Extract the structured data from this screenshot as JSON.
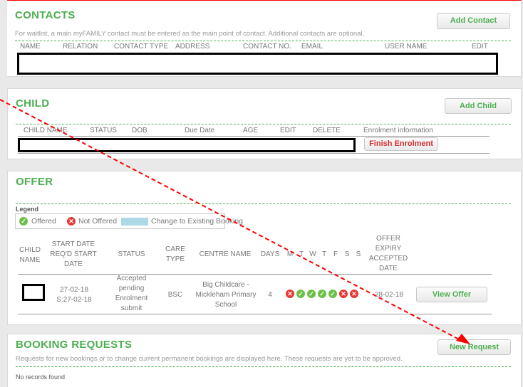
{
  "contacts": {
    "title": "CONTACTS",
    "note": "For waitlist, a main myFAMILY contact must be entered as the main point of contact. Additional contacts are optional.",
    "add_label": "Add Contact",
    "columns": [
      "NAME",
      "RELATION",
      "CONTACT TYPE",
      "ADDRESS",
      "CONTACT NO.",
      "EMAIL",
      "USER NAME",
      "EDIT"
    ]
  },
  "child": {
    "title": "CHILD",
    "add_label": "Add Child",
    "columns": [
      "CHILD NAME",
      "STATUS",
      "DOB",
      "Due Date",
      "AGE",
      "EDIT",
      "DELETE",
      "Enrolment information"
    ],
    "finish_label": "Finish Enrolment"
  },
  "offer": {
    "title": "OFFER",
    "legend_label": "Legend",
    "legend": {
      "offered": "Offered",
      "not_offered": "Not Offered",
      "change": "Change to Existing Booking"
    },
    "columns": {
      "child_name": "CHILD NAME",
      "start_date": "START DATE REQ'D START DATE",
      "status": "STATUS",
      "care_type": "CARE TYPE",
      "centre_name": "CENTRE NAME",
      "days": "DAYS",
      "weekdays": [
        "M",
        "T",
        "W",
        "T",
        "F",
        "S",
        "S"
      ],
      "expiry": "OFFER EXPIRY ACCEPTED DATE"
    },
    "row": {
      "start_date": "27-02-18",
      "reqd_start": "S:27-02-18",
      "status": "Accepted pending Enrolment submit",
      "care_type": "BSC",
      "centre": "Big Childcare - Mickleham Primary School",
      "days": "4",
      "day_status": [
        "not_offered",
        "offered",
        "offered",
        "offered",
        "offered",
        "not_offered",
        "not_offered"
      ],
      "expiry": "28-02-18",
      "view_label": "View Offer"
    }
  },
  "booking": {
    "title": "BOOKING REQUESTS",
    "note": "Requests for new bookings or to change current permanent bookings are displayed here. These requests are yet to be approved.",
    "new_label": "New Request",
    "empty": "No records found"
  },
  "colors": {
    "accent": "#4caf50",
    "danger": "#e53935",
    "annotation": "#ff0000",
    "change": "#add8e6"
  }
}
